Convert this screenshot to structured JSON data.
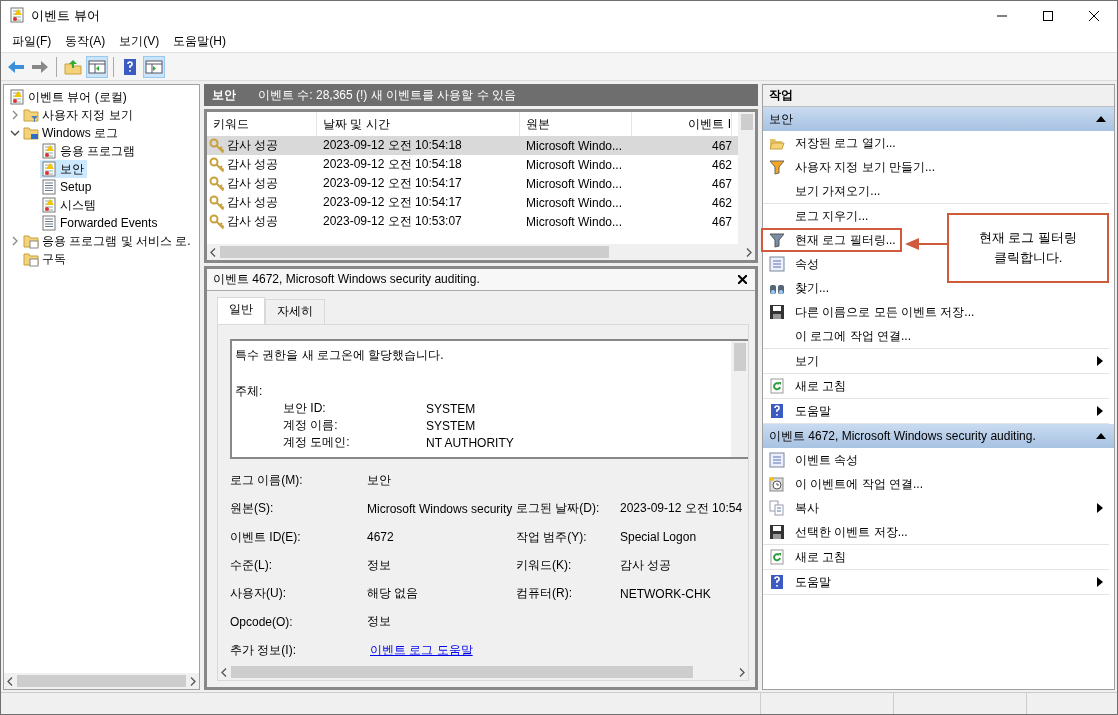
{
  "window": {
    "title": "이벤트 뷰어"
  },
  "menu": [
    {
      "label": "파일(F)"
    },
    {
      "label": "동작(A)"
    },
    {
      "label": "보기(V)"
    },
    {
      "label": "도움말(H)"
    }
  ],
  "toolbar": [
    {
      "pressed": false
    },
    {
      "pressed": false
    },
    {
      "pressed": false
    },
    {
      "pressed": true
    },
    {
      "pressed": false
    },
    {
      "pressed": true
    }
  ],
  "tree": {
    "label": "이벤트 뷰어 (로컬)",
    "children": [
      {
        "label": "사용자 지정 보기",
        "expandable": true,
        "expanded": false,
        "selected": false
      },
      {
        "label": "Windows 로그",
        "expandable": true,
        "expanded": true,
        "selected": false,
        "children": [
          {
            "label": "응용 프로그램",
            "expandable": false,
            "selected": false
          },
          {
            "label": "보안",
            "expandable": false,
            "selected": true
          },
          {
            "label": "Setup",
            "expandable": false,
            "selected": false
          },
          {
            "label": "시스템",
            "expandable": false,
            "selected": false
          },
          {
            "label": "Forwarded Events",
            "expandable": false,
            "selected": false
          }
        ]
      },
      {
        "label": "응용 프로그램 및 서비스 로.",
        "expandable": true,
        "expanded": false,
        "selected": false
      },
      {
        "label": "구독",
        "expandable": false,
        "selected": false
      }
    ]
  },
  "log_header": {
    "name": "보안",
    "summary": "이벤트 수: 28,365 (!) 새 이벤트를 사용할 수 있음"
  },
  "table": {
    "columns": [
      "키워드",
      "날짜 및 시간",
      "원본",
      "이벤트 I"
    ],
    "rows": [
      {
        "selected": true,
        "cells": [
          "감사 성공",
          "2023-09-12 오전 10:54:18",
          "Microsoft Windo...",
          "467"
        ]
      },
      {
        "selected": false,
        "cells": [
          "감사 성공",
          "2023-09-12 오전 10:54:18",
          "Microsoft Windo...",
          "462"
        ]
      },
      {
        "selected": false,
        "cells": [
          "감사 성공",
          "2023-09-12 오전 10:54:17",
          "Microsoft Windo...",
          "467"
        ]
      },
      {
        "selected": false,
        "cells": [
          "감사 성공",
          "2023-09-12 오전 10:54:17",
          "Microsoft Windo...",
          "462"
        ]
      },
      {
        "selected": false,
        "cells": [
          "감사 성공",
          "2023-09-12 오전 10:53:07",
          "Microsoft Windo...",
          "467"
        ]
      }
    ]
  },
  "detail": {
    "title": "이벤트 4672, Microsoft Windows security auditing.",
    "tabs": [
      {
        "label": "일반",
        "selected": true
      },
      {
        "label": "자세히",
        "selected": false
      }
    ],
    "description": [
      {
        "kind": "heading",
        "text": "특수 권한을 새 로그온에 할당했습니다."
      },
      {
        "kind": "heading",
        "text": "주체:"
      },
      {
        "kind": "pair",
        "label": "보안 ID:",
        "value": "SYSTEM"
      },
      {
        "kind": "pair",
        "label": "계정 이름:",
        "value": "SYSTEM"
      },
      {
        "kind": "pair",
        "label": "계정 도메인:",
        "value": "NT AUTHORITY"
      }
    ],
    "fields": [
      {
        "kind": "text",
        "label": "로그 이름(M):",
        "value": "보안"
      },
      {
        "kind": "text",
        "label": "원본(S):",
        "value": "Microsoft Windows security",
        "label_2": "로그된 날짜(D):",
        "value_2": "2023-09-12 오전 10:54"
      },
      {
        "kind": "text",
        "label": "이벤트 ID(E):",
        "value": "4672",
        "label_2": "작업 범주(Y):",
        "value_2": "Special Logon"
      },
      {
        "kind": "text",
        "label": "수준(L):",
        "value": "정보",
        "label_2": "키워드(K):",
        "value_2": "감사 성공"
      },
      {
        "kind": "text",
        "label": "사용자(U):",
        "value": "해당 없음",
        "label_2": "컴퓨터(R):",
        "value_2": "NETWORK-CHK"
      },
      {
        "kind": "text",
        "label": "Opcode(O):",
        "value": "정보"
      },
      {
        "kind": "link",
        "label": "추가 정보(I):",
        "value": "이벤트 로그 도움말"
      }
    ]
  },
  "actions": {
    "title": "작업",
    "sections": [
      {
        "title": "보안",
        "expanded": true,
        "groups": [
          [
            {
              "label": "저장된 로그 열기...",
              "submenu": false,
              "highlighted": false
            },
            {
              "label": "사용자 지정 보기 만들기...",
              "submenu": false,
              "highlighted": false
            },
            {
              "label": "보기 가져오기...",
              "submenu": false,
              "highlighted": false
            }
          ],
          [
            {
              "label": "로그 지우기...",
              "submenu": false,
              "highlighted": false
            },
            {
              "label": "현재 로그 필터링...",
              "submenu": false,
              "highlighted": true
            },
            {
              "label": "속성",
              "submenu": false,
              "highlighted": false
            },
            {
              "label": "찾기...",
              "submenu": false,
              "highlighted": false
            },
            {
              "label": "다른 이름으로 모든 이벤트 저장...",
              "submenu": false,
              "highlighted": false
            },
            {
              "label": "이 로그에 작업 연결...",
              "submenu": false,
              "highlighted": false
            }
          ],
          [
            {
              "label": "보기",
              "submenu": true,
              "highlighted": false
            }
          ],
          [
            {
              "label": "새로 고침",
              "submenu": false,
              "highlighted": false
            }
          ],
          [
            {
              "label": "도움말",
              "submenu": true,
              "highlighted": false
            }
          ]
        ]
      },
      {
        "title": "이벤트 4672, Microsoft Windows security auditing.",
        "expanded": true,
        "groups": [
          [
            {
              "label": "이벤트 속성",
              "submenu": false,
              "highlighted": false
            },
            {
              "label": "이 이벤트에 작업 연결...",
              "submenu": false,
              "highlighted": false
            },
            {
              "label": "복사",
              "submenu": true,
              "highlighted": false
            },
            {
              "label": "선택한 이벤트 저장...",
              "submenu": false,
              "highlighted": false
            }
          ],
          [
            {
              "label": "새로 고침",
              "submenu": false,
              "highlighted": false
            }
          ],
          [
            {
              "label": "도움말",
              "submenu": true,
              "highlighted": false
            }
          ]
        ]
      }
    ]
  },
  "callout": {
    "text": "현재 로그 필터링 클릭합니다."
  }
}
